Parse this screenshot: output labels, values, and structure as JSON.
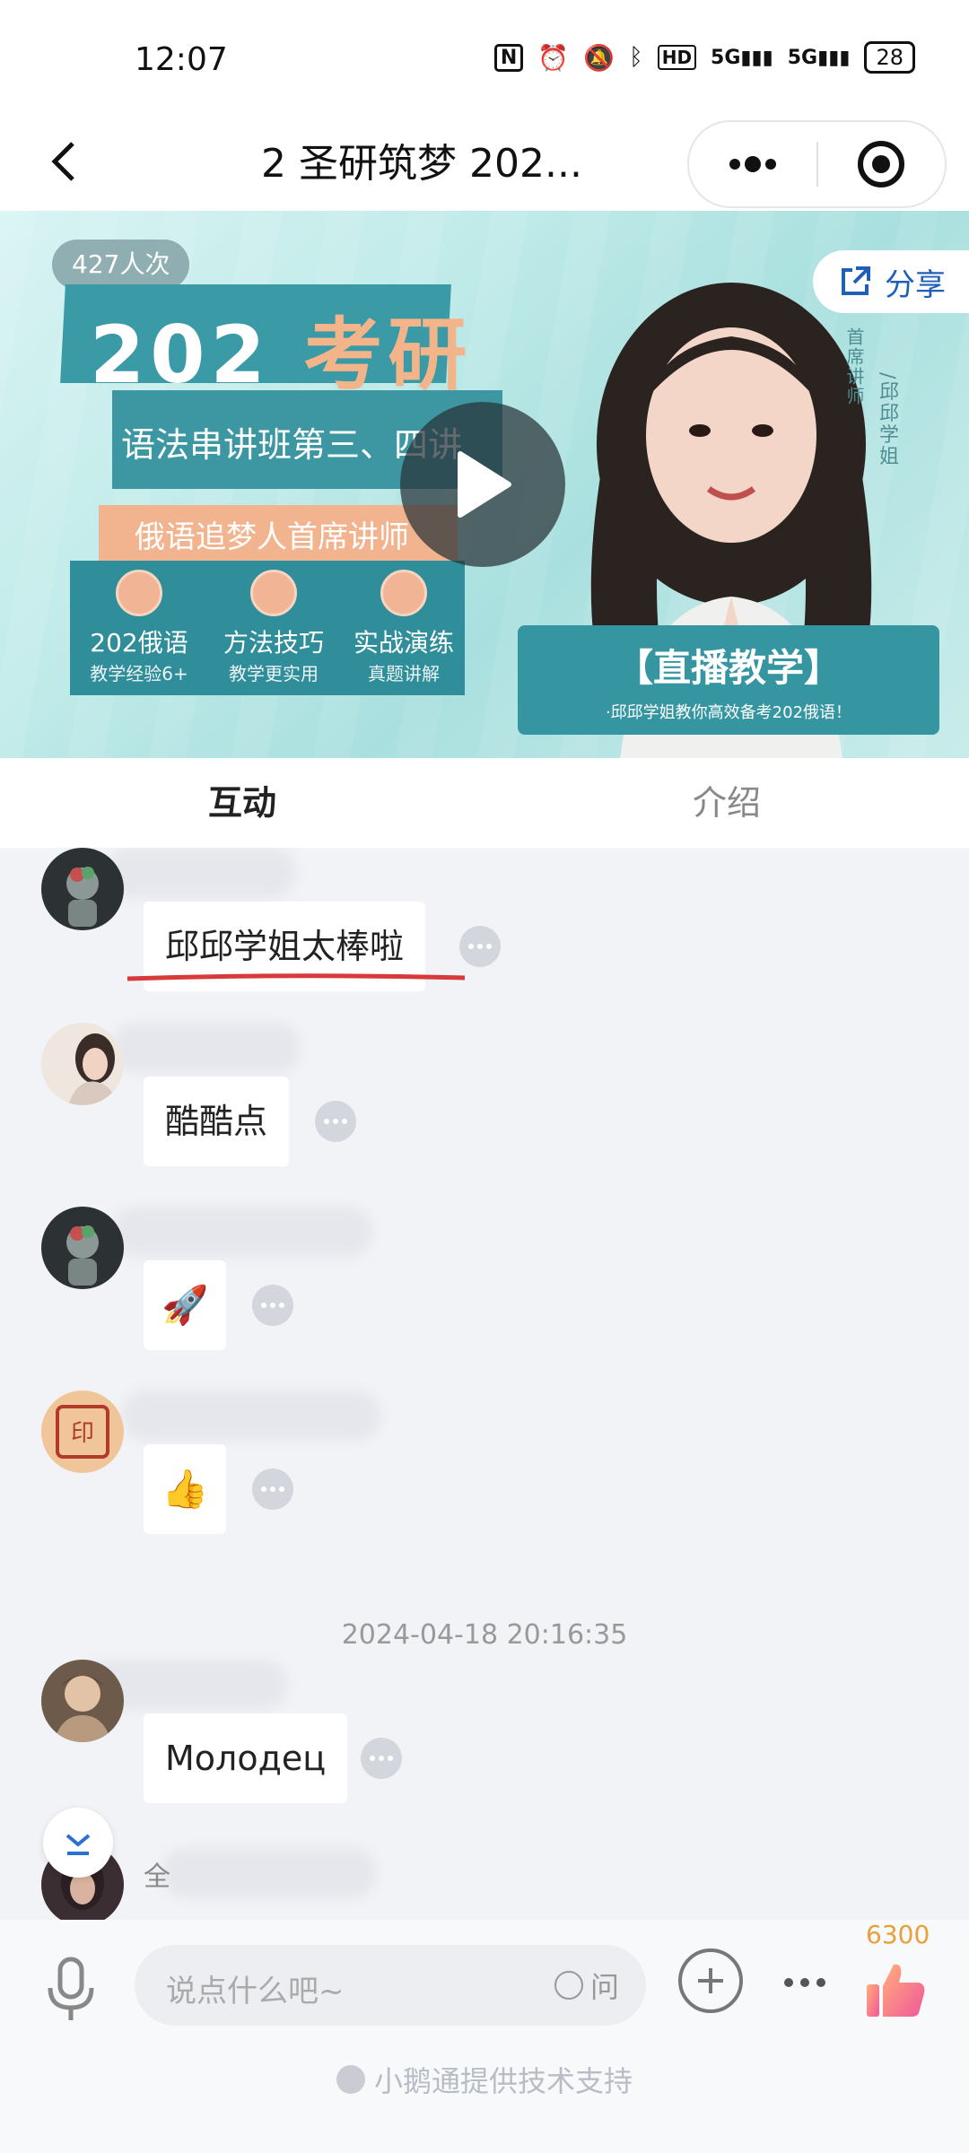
{
  "status_bar": {
    "time": "12:07",
    "icons": [
      "nfc-icon",
      "alarm-icon",
      "mute-icon",
      "bluetooth-icon",
      "hd-icon",
      "signal-5g-icon",
      "signal-5g-icon"
    ],
    "hd_label": "HD",
    "signal1_label": "5G",
    "signal2_label": "5G",
    "battery": "28"
  },
  "nav": {
    "title": "2 圣研筑梦 202...",
    "back_icon": "chevron-left-icon",
    "menu_icon": "more-dots-icon",
    "close_icon": "target-icon"
  },
  "banner": {
    "views": "427人次",
    "headline_num": "202",
    "headline_word": "考研",
    "subtitle": "语法串讲班第三、四讲",
    "tag": "俄语追梦人首席讲师",
    "features": [
      {
        "title": "202俄语",
        "desc": "教学经验6+"
      },
      {
        "title": "方法技巧",
        "desc": "教学更实用"
      },
      {
        "title": "实战演练",
        "desc": "真题讲解"
      }
    ],
    "vertical_role": "首席讲师",
    "vertical_name": "/邱邱学姐",
    "live_title": "【直播教学】",
    "live_sub": "·邱邱学姐教你高效备考202俄语！",
    "share_label": "分享",
    "colors": {
      "teal": "#3595a0",
      "peach": "#f2b48e"
    }
  },
  "tabs": [
    {
      "label": "互动",
      "active": true
    },
    {
      "label": "介绍",
      "active": false
    }
  ],
  "chat": {
    "messages": [
      {
        "text": "邱邱学姐太棒啦",
        "avatar": "astronaut-avatar"
      },
      {
        "text": "酷酷点",
        "avatar": "girl-avatar"
      },
      {
        "text": "🚀",
        "avatar": "astronaut-avatar"
      },
      {
        "text": "👍",
        "avatar": "seal-avatar"
      },
      {
        "text": "Молодец",
        "avatar": "photo-avatar"
      }
    ],
    "timestamp": "2024-04-18 20:16:35",
    "partial_name_char": "全"
  },
  "input": {
    "placeholder": "说点什么吧~",
    "ask_label": "问",
    "like_count": "6300"
  },
  "footer": {
    "powered_by": "小鹅通提供技术支持"
  }
}
